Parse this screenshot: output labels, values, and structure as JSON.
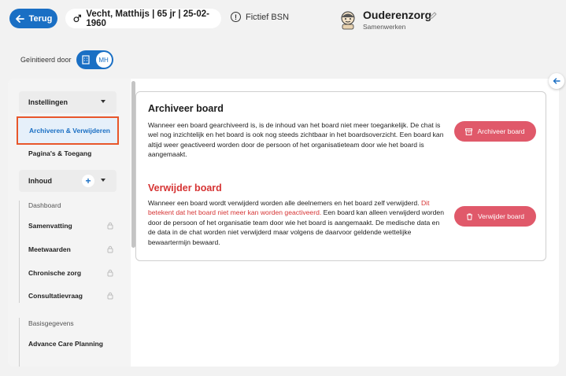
{
  "header": {
    "back_label": "Terug",
    "patient": "Vecht, Matthijs | 65 jr | 25-02-1960",
    "bsn_label": "Fictief BSN",
    "org_name": "Ouderenzorg",
    "org_sub": "Samenwerken"
  },
  "initiated": {
    "label": "Geïnitieerd door",
    "toggle_initials": "MH"
  },
  "sidebar": {
    "instellingen": "Instellingen",
    "items": [
      {
        "label": "Archiveren & Verwijderen"
      },
      {
        "label": "Pagina's & Toegang"
      }
    ],
    "inhoud": "Inhoud",
    "inhoud_plus": "+",
    "section_dashboard": "Dashboard",
    "dashboard_items": [
      {
        "label": "Samenvatting"
      },
      {
        "label": "Meetwaarden"
      },
      {
        "label": "Chronische zorg"
      },
      {
        "label": "Consultatievraag"
      }
    ],
    "section_basis": "Basisgegevens",
    "basis_items": [
      {
        "label": "Advance Care Planning"
      }
    ]
  },
  "archive": {
    "title": "Archiveer board",
    "text": "Wanneer een board gearchiveerd is, is de inhoud van het board niet meer toegankelijk. De chat is wel nog inzichtelijk en het board is ook nog steeds zichtbaar in het boardsoverzicht. Een board kan altijd weer geactiveerd worden door de persoon of het organisatieteam door wie het board is aangemaakt.",
    "button": "Archiveer board"
  },
  "delete": {
    "title": "Verwijder board",
    "text_before": "Wanneer een board wordt verwijderd worden alle deelnemers en het board zelf verwijderd. ",
    "text_red": "Dit betekent dat het board niet meer kan worden geactiveerd.",
    "text_after": " Een board kan alleen verwijderd worden door de persoon of het organisatie team door wie het board is aangemaakt. De medische data en de data in de chat worden niet verwijderd maar volgens de daarvoor geldende wettelijke bewaartermijn bewaard.",
    "button": "Verwijder board"
  },
  "colors": {
    "primary": "#1a6fc4",
    "danger": "#d63434",
    "button_danger": "#e0596a",
    "highlight": "#e8562a"
  }
}
